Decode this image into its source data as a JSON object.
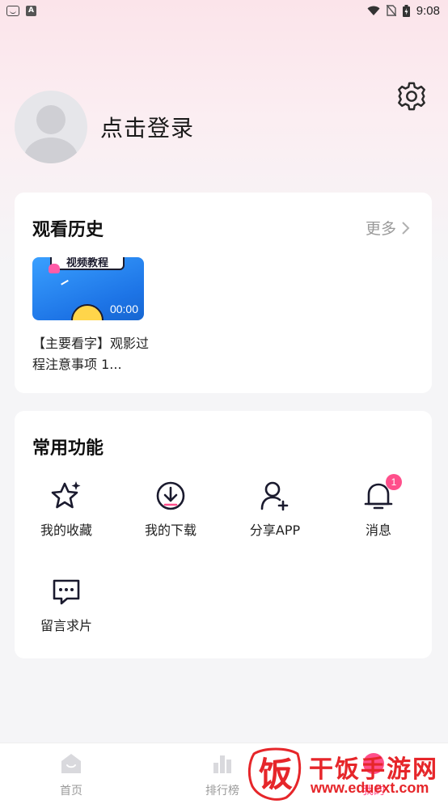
{
  "status_bar": {
    "time": "9:08",
    "icons": [
      "app-icon",
      "a-icon",
      "wifi-icon",
      "no-sim-icon",
      "battery-icon"
    ]
  },
  "profile": {
    "login_text": "点击登录",
    "avatar": "avatar-placeholder",
    "settings_icon": "gear-icon"
  },
  "history": {
    "title": "观看历史",
    "more_label": "更多",
    "videos": [
      {
        "thumb_banner": "视频教程",
        "duration": "00:00",
        "title": "【主要看字】观影过程注意事项 1..."
      }
    ]
  },
  "functions": {
    "title": "常用功能",
    "items": [
      {
        "label": "我的收藏",
        "icon": "star-icon"
      },
      {
        "label": "我的下载",
        "icon": "download-icon"
      },
      {
        "label": "分享APP",
        "icon": "add-user-icon"
      },
      {
        "label": "消息",
        "icon": "bell-icon",
        "badge": "1"
      },
      {
        "label": "留言求片",
        "icon": "chat-icon"
      }
    ]
  },
  "bottom_nav": {
    "items": [
      {
        "label": "首页",
        "icon": "home-icon"
      },
      {
        "label": "排行榜",
        "icon": "chart-icon"
      },
      {
        "label": "我的",
        "icon": "user-icon",
        "active": true
      }
    ]
  },
  "watermark": {
    "title": "干饭手游网",
    "url": "www.eduext.com",
    "logo_char": "饭"
  },
  "colors": {
    "accent": "#ff4f8b",
    "watermark": "#e6262a",
    "muted_text": "#9a9a9a",
    "thumb_blue": "#2b8af0"
  }
}
